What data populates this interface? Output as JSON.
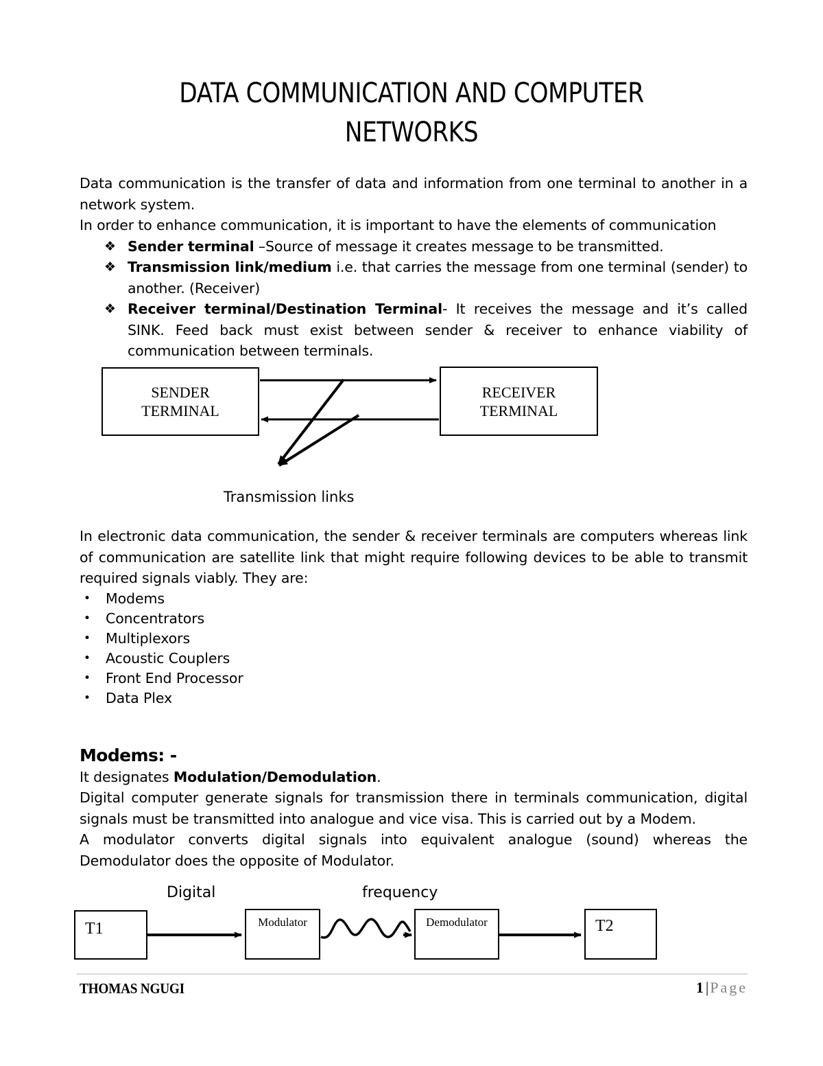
{
  "document": {
    "title": "DATA COMMUNICATION AND COMPUTER NETWORKS",
    "intro_para_1": "Data communication is the transfer of data and information from one terminal to another in a network system.",
    "intro_para_2": "In order to enhance communication, it is important to have the elements of communication",
    "elements": [
      {
        "bullet": "❖",
        "term": "Sender terminal",
        "rest": " –Source of message it creates message to be transmitted."
      },
      {
        "bullet": "❖",
        "term": "Transmission link/medium",
        "rest": " i.e. that carries the message from one terminal (sender) to another. (Receiver)"
      },
      {
        "bullet": "❖",
        "term": "Receiver terminal/Destination Terminal",
        "rest": "- It receives the message and it’s called SINK. Feed back must exist between sender & receiver to enhance viability of communication between terminals."
      }
    ],
    "diagram_sender_receiver": {
      "sender_line1": "SENDER",
      "sender_line2": "TERMINAL",
      "receiver_line1": "RECEIVER",
      "receiver_line2": "TERMINAL",
      "caption": "Transmission links"
    },
    "para_electronic": "In electronic data communication, the sender & receiver terminals are computers whereas link of communication are satellite link that might require following devices to be able to transmit required signals viably. They are:",
    "devices_bullet": "•",
    "devices": [
      "Modems",
      "Concentrators",
      "Multiplexors",
      "Acoustic Couplers",
      "Front End Processor",
      "Data Plex"
    ],
    "modems_heading": "Modems: -",
    "modems_line_prefix": "It designates ",
    "modems_line_bold": "Modulation/Demodulation",
    "modems_line_suffix": ".",
    "modems_para_1": "Digital computer generate signals for transmission there in terminals communication, digital signals must be transmitted into analogue and vice visa. This is carried out by a Modem.",
    "modems_para_2": "A modulator converts digital signals into equivalent analogue (sound) whereas the Demodulator does the opposite of Modulator.",
    "diagram_modem": {
      "label_digital": "Digital",
      "label_frequency": "frequency",
      "box_t1": "T1",
      "box_modulator": "Modulator",
      "box_demodulator": "Demodulator",
      "box_t2": "T2"
    },
    "footer": {
      "author": "THOMAS NGUGI",
      "page_number": "1",
      "separator": "|",
      "page_word": "Page"
    }
  },
  "colors": {
    "text": "#000000",
    "footer_rule": "#d9d9d9",
    "footer_word": "#808080",
    "page_background": "#ffffff"
  }
}
